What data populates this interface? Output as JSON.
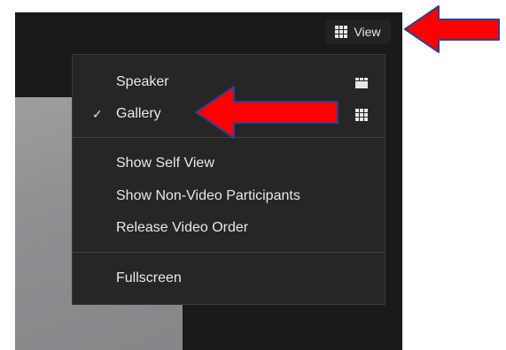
{
  "view_button": {
    "label": "View",
    "icon": "gallery-grid-icon"
  },
  "view_menu": {
    "layout_items": [
      {
        "label": "Speaker",
        "icon": "speaker-view-icon",
        "checked": false
      },
      {
        "label": "Gallery",
        "icon": "gallery-grid-icon",
        "checked": true,
        "check_mark": "✓"
      }
    ],
    "option_items": [
      {
        "label": "Show Self View"
      },
      {
        "label": "Show Non-Video Participants"
      },
      {
        "label": "Release Video Order"
      }
    ],
    "screen_items": [
      {
        "label": "Fullscreen"
      }
    ]
  },
  "annotations": {
    "arrow_color": "#ff0000",
    "arrow_outline": "#2a3f9a"
  },
  "colors": {
    "window_bg": "#1a1a1a",
    "menu_bg": "#262626",
    "menu_text": "#e8e8e8",
    "video_tile": "#8e8e91"
  }
}
